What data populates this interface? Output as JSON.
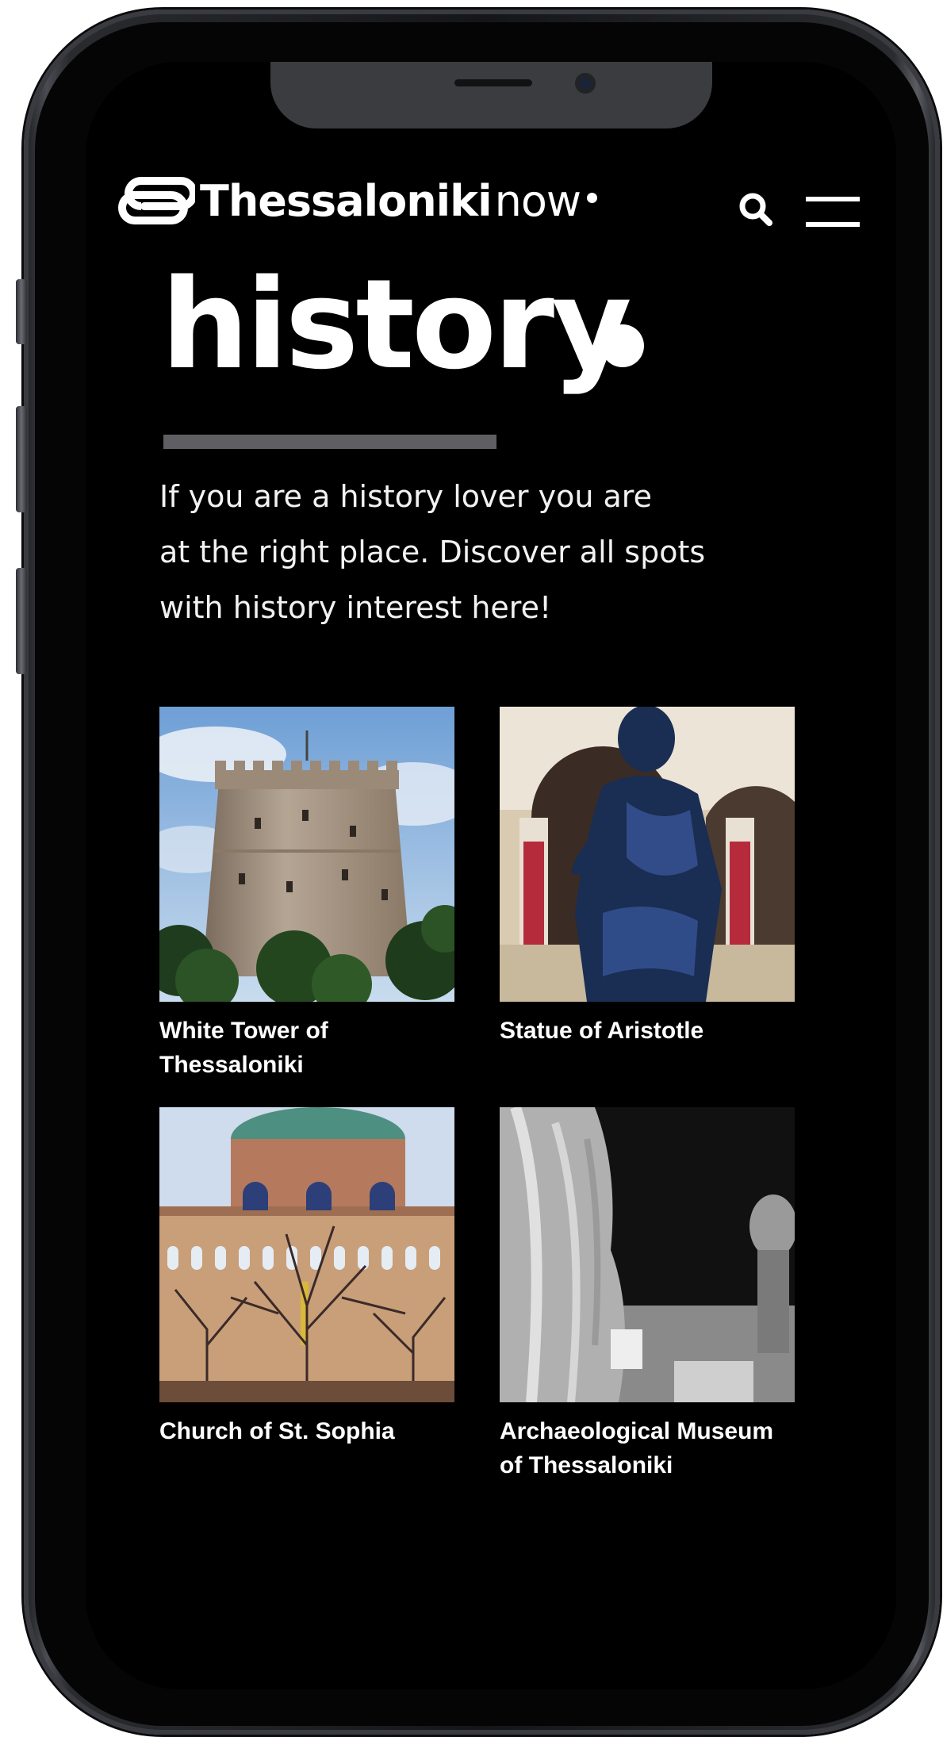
{
  "header": {
    "logo_main": "Thessaloniki",
    "logo_suffix": "now"
  },
  "icons": {
    "search": "search-icon",
    "menu": "hamburger-menu-icon",
    "logo": "thessaloniki-logo-mark"
  },
  "page": {
    "title": "history",
    "intro_lines": [
      "If you are a history lover you are",
      "at the right place. Discover all spots",
      "with history interest here!"
    ]
  },
  "cards": [
    {
      "title_lines": [
        "White Tower of",
        "Thessaloniki"
      ]
    },
    {
      "title_lines": [
        "Statue of Aristotle"
      ]
    },
    {
      "title_lines": [
        "Church of St. Sophia"
      ]
    },
    {
      "title_lines": [
        "Archaeological Museum",
        "of Thessaloniki"
      ]
    }
  ],
  "colors": {
    "screen_background": "#000000",
    "text": "#ffffff",
    "title_underline": "#5f5f63"
  }
}
